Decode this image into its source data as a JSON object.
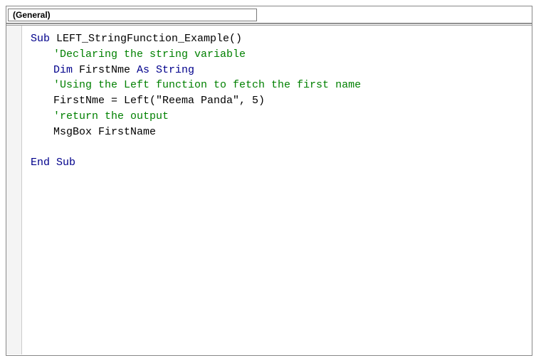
{
  "dropdown": {
    "label": "(General)"
  },
  "code": {
    "sub_kw": "Sub",
    "sub_name": " LEFT_StringFunction_Example()",
    "comment1": "'Declaring the string variable",
    "dim_kw": "Dim",
    "dim_var": " FirstNme ",
    "as_kw": "As String",
    "comment2": "'Using the Left function to fetch the first name",
    "assign_line": "FirstNme = Left(\"Reema Panda\", 5)",
    "comment3": "'return the output",
    "msgbox_line": "MsgBox FirstName",
    "end_sub": "End Sub"
  }
}
